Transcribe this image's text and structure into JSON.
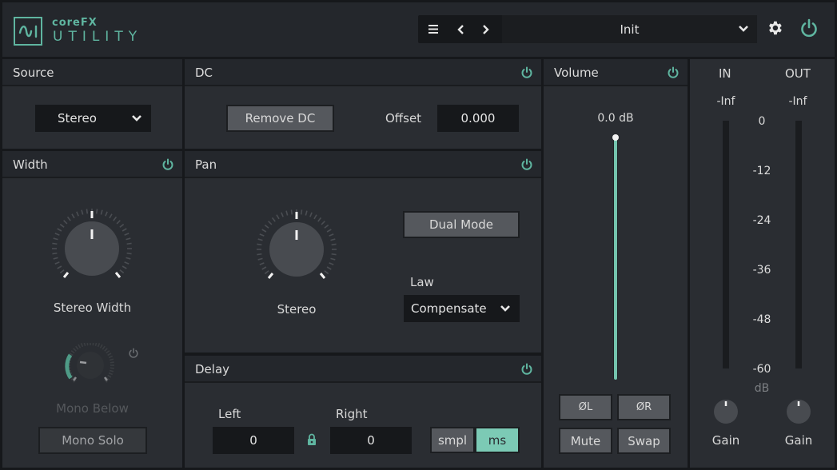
{
  "header": {
    "brand_small": "coreFX",
    "brand_big": "UTILITY",
    "menu_icon": "hamburger-menu-icon",
    "prev_icon": "chevron-left-icon",
    "next_icon": "chevron-right-icon",
    "preset_name": "Init",
    "settings_icon": "gear-icon",
    "power_icon": "power-icon"
  },
  "accent_color": "#5fb5a0",
  "source": {
    "title": "Source",
    "mode": "Stereo"
  },
  "dc": {
    "title": "DC",
    "remove_label": "Remove DC",
    "offset_label": "Offset",
    "offset_value": "0.000"
  },
  "width": {
    "title": "Width",
    "knob_label": "Stereo Width",
    "knob_value_fraction": 0.5,
    "mono_below_label": "Mono Below",
    "mono_below_fraction": 0.15,
    "mono_solo_label": "Mono Solo"
  },
  "pan": {
    "title": "Pan",
    "knob_label": "Stereo",
    "knob_value_fraction": 0.5,
    "dual_mode_label": "Dual Mode",
    "law_label": "Law",
    "law_value": "Compensate"
  },
  "delay": {
    "title": "Delay",
    "left_label": "Left",
    "left_value": "0",
    "right_label": "Right",
    "right_value": "0",
    "lock_icon": "lock-icon",
    "unit_sample": "smpl",
    "unit_ms": "ms",
    "active_unit": "ms"
  },
  "volume": {
    "title": "Volume",
    "value_text": "0.0 dB",
    "slider_fraction": 1.0,
    "phase_left": "ØL",
    "phase_right": "ØR",
    "mute": "Mute",
    "swap": "Swap"
  },
  "meters": {
    "in_label": "IN",
    "out_label": "OUT",
    "in_peak": "-Inf",
    "out_peak": "-Inf",
    "scale": [
      "0",
      "-12",
      "-24",
      "-36",
      "-48",
      "-60"
    ],
    "unit": "dB",
    "in_gain_label": "Gain",
    "out_gain_label": "Gain"
  }
}
